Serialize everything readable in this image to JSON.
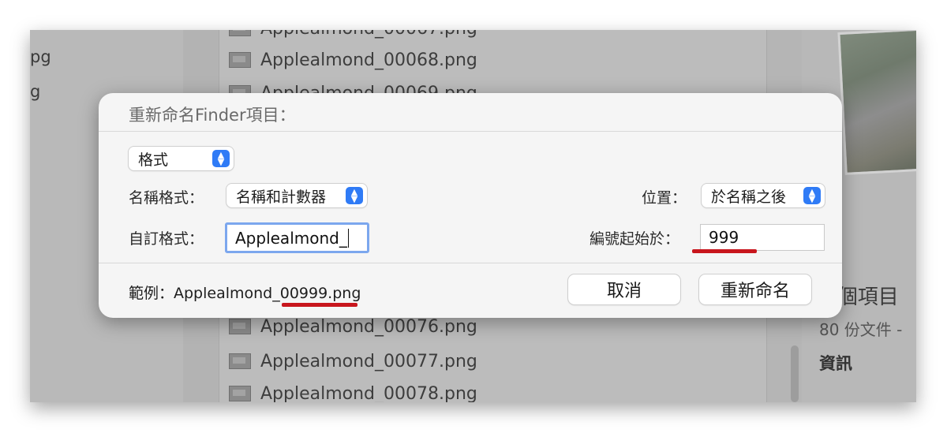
{
  "background": {
    "sidebar_fragments": [
      "pg",
      "g"
    ],
    "files_above": [
      "Applealmond_00067.png",
      "Applealmond_00068.png",
      "Applealmond_00069.png"
    ],
    "files_below": [
      "Applealmond_00076.png",
      "Applealmond_00077.png",
      "Applealmond_00078.png"
    ],
    "preview": {
      "items_count": "0 個項目",
      "docs_count": "80 份文件 -",
      "info_label": "資訊"
    }
  },
  "dialog": {
    "title": "重新命名Finder項目：",
    "mode_popup": "格式",
    "name_format_label": "名稱格式：",
    "name_format_value": "名稱和計數器",
    "position_label": "位置：",
    "position_value": "於名稱之後",
    "custom_format_label": "自訂格式：",
    "custom_format_value": "Applealmond_",
    "start_number_label": "編號起始於：",
    "start_number_value": "999",
    "example_text": "範例：Applealmond_00999.png",
    "cancel_label": "取消",
    "rename_label": "重新命名"
  },
  "colors": {
    "accent_blue": "#2f7bf6",
    "focus_ring": "#7ca7ee",
    "annotation_red": "#c8161d"
  }
}
